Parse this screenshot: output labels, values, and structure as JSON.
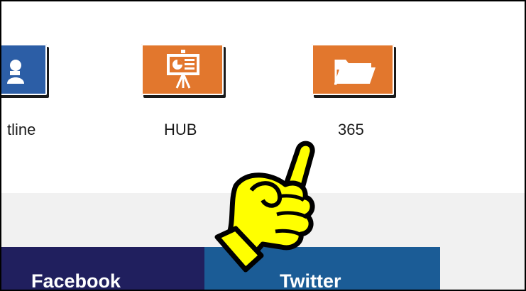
{
  "apps": [
    {
      "id": "outline",
      "label": "tline",
      "icon": "user-card-icon",
      "color": "#2c5ea6"
    },
    {
      "id": "hub",
      "label": "HUB",
      "icon": "presentation-icon",
      "color": "#e2772d"
    },
    {
      "id": "365",
      "label": "365",
      "icon": "folder-icon",
      "color": "#e2772d"
    }
  ],
  "social": {
    "facebook": {
      "label": "Facebook",
      "color": "#201f5e"
    },
    "twitter": {
      "label": "Twitter",
      "color": "#1b5c96"
    }
  },
  "pointer": {
    "icon": "pointing-hand-icon",
    "color": "#ffff00"
  }
}
